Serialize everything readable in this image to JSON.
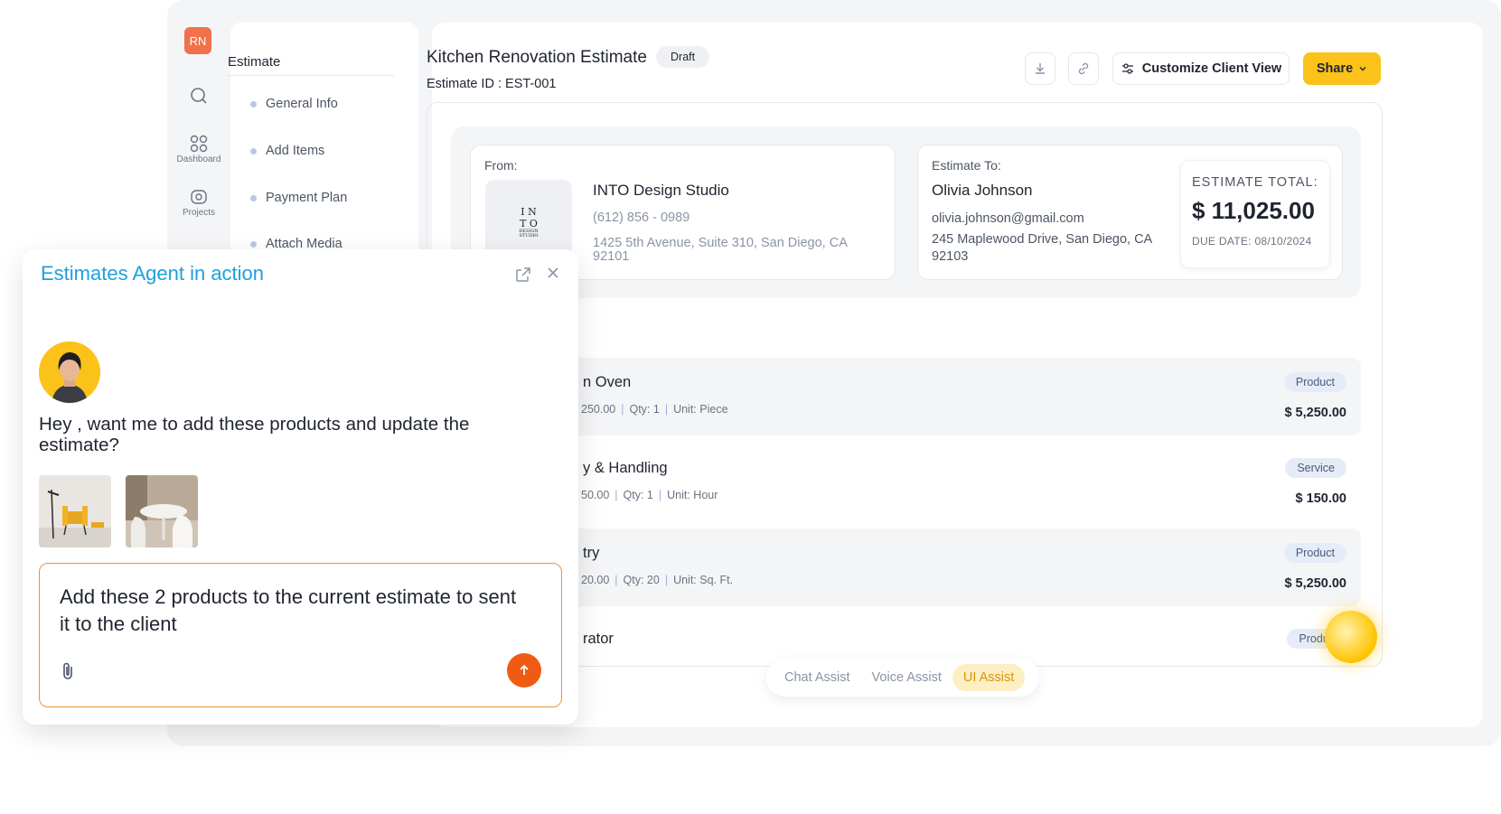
{
  "rail": {
    "user_initials": "RN",
    "items": [
      {
        "icon": "search-icon",
        "label": ""
      },
      {
        "icon": "dashboard-icon",
        "label": "Dashboard"
      },
      {
        "icon": "projects-icon",
        "label": "Projects"
      }
    ]
  },
  "subnav": {
    "title": "Estimate",
    "items": [
      "General Info",
      "Add Items",
      "Payment Plan",
      "Attach Media"
    ]
  },
  "header": {
    "title": "Kitchen Renovation Estimate",
    "status": "Draft",
    "estimate_id": "Estimate ID : EST-001",
    "customize_label": "Customize Client View",
    "share_label": "Share"
  },
  "from": {
    "label": "From:",
    "company": "INTO Design Studio",
    "logo_text": [
      "I N",
      "T O",
      "DESIGN",
      "STUDIO"
    ],
    "phone": "(612) 856 - 0989",
    "address_line1": "1425 5th Avenue, Suite 310, San Diego, CA",
    "address_line2": "92101"
  },
  "to": {
    "label": "Estimate To:",
    "name": "Olivia Johnson",
    "email": "olivia.johnson@gmail.com",
    "address_line1": "245 Maplewood Drive, San Diego, CA",
    "address_line2": "92103"
  },
  "total": {
    "label": "ESTIMATE TOTAL:",
    "value": "$ 11,025.00",
    "due": "DUE DATE: 08/10/2024"
  },
  "items": [
    {
      "name": "n Oven",
      "price_part": "250.00",
      "qty": "Qty: 1",
      "unit": "Unit: Piece",
      "type": "Product",
      "amount": "$ 5,250.00"
    },
    {
      "name": "y & Handling",
      "price_part": "50.00",
      "qty": "Qty: 1",
      "unit": "Unit: Hour",
      "type": "Service",
      "amount": "$ 150.00"
    },
    {
      "name": "try",
      "price_part": "20.00",
      "qty": "Qty: 20",
      "unit": "Unit: Sq. Ft.",
      "type": "Product",
      "amount": "$ 5,250.00"
    },
    {
      "name": "rator",
      "price_part": "",
      "qty": "",
      "unit": "",
      "type": "Produc",
      "amount": ""
    }
  ],
  "assist": {
    "tabs": [
      "Chat Assist",
      "Voice Assist",
      "UI Assist"
    ],
    "active": "UI Assist"
  },
  "chat": {
    "title": "Estimates Agent in action",
    "message": "Hey , want me to add these products and update the estimate?",
    "input_value": "Add these 2 products to the current estimate to sent it to the client"
  },
  "colors": {
    "accent": "#fbc21a",
    "chat_title": "#1ea0db",
    "send": "#f05a12",
    "input_border": "#f0913a"
  }
}
